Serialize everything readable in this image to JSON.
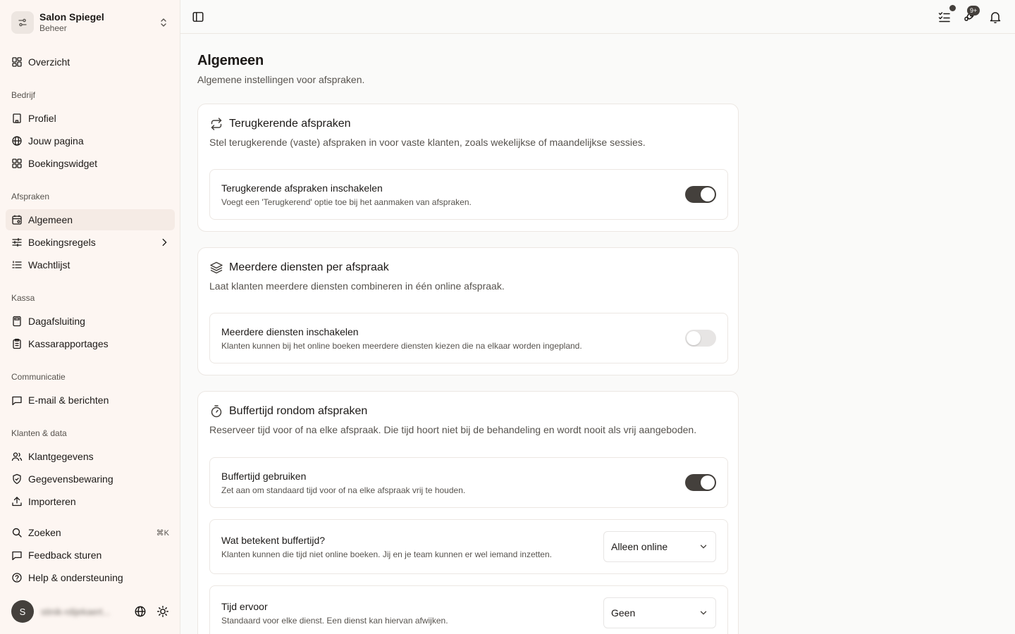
{
  "org": {
    "name": "Salon Spiegel",
    "sub": "Beheer"
  },
  "nav": {
    "overview": "Overzicht",
    "sections": {
      "bedrijf": "Bedrijf",
      "afspraken": "Afspraken",
      "kassa": "Kassa",
      "communicatie": "Communicatie",
      "klanten": "Klanten & data"
    },
    "items": {
      "profiel": "Profiel",
      "jouw_pagina": "Jouw pagina",
      "boekingswidget": "Boekingswidget",
      "algemeen": "Algemeen",
      "boekingsregels": "Boekingsregels",
      "wachtlijst": "Wachtlijst",
      "dagafsluiting": "Dagafsluiting",
      "kassarapportages": "Kassarapportages",
      "email": "E-mail & berichten",
      "klantgegevens": "Klantgegevens",
      "gegevensbewaring": "Gegevensbewaring",
      "importeren": "Importeren"
    },
    "footer": {
      "zoeken": "Zoeken",
      "zoeken_shortcut": "⌘K",
      "feedback": "Feedback sturen",
      "help": "Help & ondersteuning"
    }
  },
  "user": {
    "initial": "S",
    "name": "stinik-rdijekaert..."
  },
  "topbar": {
    "notifications_badge": "9+"
  },
  "page": {
    "title": "Algemeen",
    "subtitle": "Algemene instellingen voor afspraken."
  },
  "cards": {
    "recurring": {
      "title": "Terugkerende afspraken",
      "desc": "Stel terugkerende (vaste) afspraken in voor vaste klanten, zoals wekelijkse of maandelijkse sessies.",
      "setting_title": "Terugkerende afspraken inschakelen",
      "setting_desc": "Voegt een 'Terugkerend' optie toe bij het aanmaken van afspraken.",
      "enabled": true
    },
    "multi": {
      "title": "Meerdere diensten per afspraak",
      "desc": "Laat klanten meerdere diensten combineren in één online afspraak.",
      "setting_title": "Meerdere diensten inschakelen",
      "setting_desc": "Klanten kunnen bij het online boeken meerdere diensten kiezen die na elkaar worden ingepland.",
      "enabled": false
    },
    "buffer": {
      "title": "Buffertijd rondom afspraken",
      "desc": "Reserveer tijd voor of na elke afspraak. Die tijd hoort niet bij de behandeling en wordt nooit als vrij aangeboden.",
      "use_title": "Buffertijd gebruiken",
      "use_desc": "Zet aan om standaard tijd voor of na elke afspraak vrij te houden.",
      "use_enabled": true,
      "meaning_title": "Wat betekent buffertijd?",
      "meaning_desc": "Klanten kunnen die tijd niet online boeken. Jij en je team kunnen er wel iemand inzetten.",
      "meaning_value": "Alleen online",
      "before_title": "Tijd ervoor",
      "before_desc": "Standaard voor elke dienst. Een dienst kan hiervan afwijken.",
      "before_value": "Geen"
    }
  }
}
